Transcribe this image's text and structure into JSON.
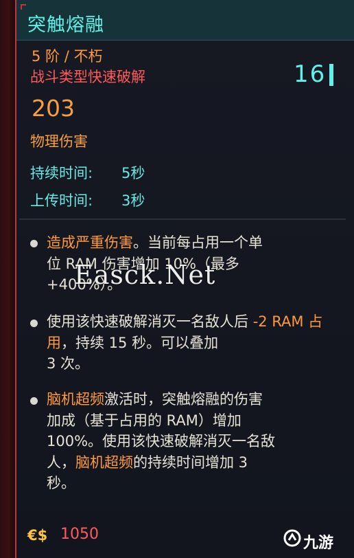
{
  "item": {
    "name": "突触熔融",
    "tier": "5 阶 / 不朽",
    "type": "战斗类型快速破解",
    "ram_cost": "16",
    "damage": "203",
    "damage_type": "物理伤害"
  },
  "stats": {
    "duration_label": "持续时间:",
    "duration_value": "5秒",
    "upload_label": "上传时间:",
    "upload_value": "3秒"
  },
  "effects": {
    "e1_hl": "造成严重伤害",
    "e1_rest_a": "。当前每占用一个单",
    "e1_rest_b": "位 RAM 伤害增加 10%（最多",
    "e1_rest_c": "+400%）。",
    "e2_a": "使用该快速破解消灭一名敌人后 ",
    "e2_hl": "-2 RAM 占用",
    "e2_b": "，持续 15 秒。可以叠加",
    "e2_c": "3 次。",
    "e3_hl1": "脑机超频",
    "e3_a": "激活时，突触熔融的伤害",
    "e3_b": "加成（基于占用的 RAM）增加",
    "e3_c": "100%。使用该快速破解消灭一名敌",
    "e3_d": "人，",
    "e3_hl2": "脑机超频",
    "e3_e": "的持续时间增加 3",
    "e3_f": "秒。"
  },
  "footer": {
    "currency_symbol": "€$",
    "price": "1050",
    "logo_text": "九游"
  },
  "watermark": "Easck.Net",
  "colors": {
    "title": "#5ff0e6",
    "highlight": "#ff9a3c",
    "type_red": "#ff5959",
    "border_red": "#c3353a"
  }
}
